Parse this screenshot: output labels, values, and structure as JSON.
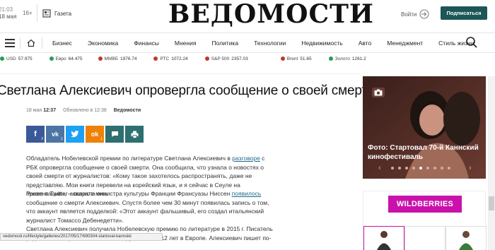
{
  "topbar": {
    "date_time": "21:03",
    "date": "18 мая",
    "age": "16+",
    "gazeta": "Газета",
    "logo": "ВЕДОМОСТИ",
    "login": "Войти",
    "subscribe": "Подписаться"
  },
  "nav": {
    "items": [
      "Бизнес",
      "Экономика",
      "Финансы",
      "Мнения",
      "Политика",
      "Технологии",
      "Недвижимость",
      "Авто",
      "Менеджмент",
      "Стиль жизни"
    ]
  },
  "ticker": [
    {
      "name": "USD",
      "value": "57.975",
      "dir": "up"
    },
    {
      "name": "Евро",
      "value": "64.475",
      "dir": "up"
    },
    {
      "name": "ММВБ",
      "value": "1976.74",
      "dir": "dn"
    },
    {
      "name": "РТС",
      "value": "1072.24",
      "dir": "dn"
    },
    {
      "name": "S&P 500",
      "value": "2357.03",
      "dir": "dn"
    },
    {
      "name": "Brent",
      "value": "51.65",
      "dir": "dn"
    },
    {
      "name": "Золото",
      "value": "1261.2",
      "dir": "up"
    }
  ],
  "article": {
    "headline": "Светлана Алексиевич опровергла сообщение о своей смерти",
    "date": "18 мая",
    "time": "12:37",
    "updated": "Обновлено в 12:38",
    "source": "Ведомости",
    "share": {
      "fb": "f",
      "fb_count": "2",
      "vk": "vk",
      "vk_count": "1",
      "tw": "t",
      "ok": "ok",
      "ok_count": "1"
    },
    "p1_a": "Обладатель Нобелевской премии по литературе Светлана Алексиевич в ",
    "p1_link": "разговоре",
    "p1_b": " с РБК опровергла сообщение о своей смерти. Она сообщила, что узнала о новостях о своей смерти от журналистов: «Кому такое захотелось распространять, даже не представляю. Мои книги перевели на корейский язык, и я сейчас в Сеуле на презентации», – сказала она.",
    "p2_a": "Ранее в Twitter-аккаунте министра культуры Франции Франсуазы Ниссен ",
    "p2_link": "появилось",
    "p2_b": " сообщение о смерти Алексиевич. Спустя более чем 30 минут появилась запись о том, что аккаунт является подделкой: «Этот аккаунт фальшивый, его создал итальянский журналист Томассо Дебенедетти».",
    "p3": "Светлана Алексиевич получила Нобелевскую премию по литературе в 2015 г. Писатель родилась на Украине, живет в Беларуси и жила 12 лет в Европе. Алексиевич пишет по-"
  },
  "promo": {
    "caption": "Фото: Стартовал 70-й Каннский кинофестиваль"
  },
  "ad": {
    "brand": "WILDBERRIES"
  },
  "status_url": "vedomosti.ru/lifestyle/galleries/2017/05/17/690304-startoval-kannskii",
  "colors": {
    "brand": "#1d5657",
    "wildberries": "#cb11ab",
    "link": "#1d6b8c"
  }
}
